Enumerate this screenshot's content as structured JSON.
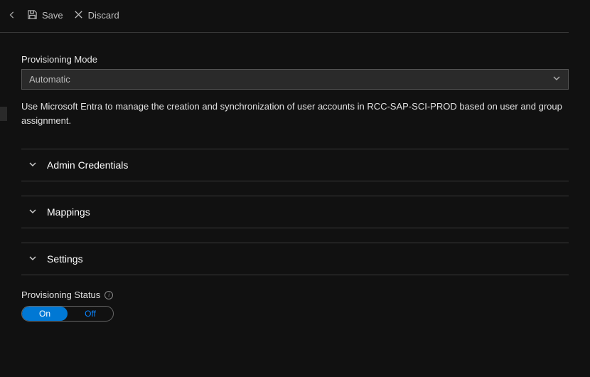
{
  "toolbar": {
    "save_label": "Save",
    "discard_label": "Discard"
  },
  "provisioning_mode": {
    "label": "Provisioning Mode",
    "value": "Automatic"
  },
  "description": "Use Microsoft Entra to manage the creation and synchronization of user accounts in RCC-SAP-SCI-PROD based on user and group assignment.",
  "sections": {
    "admin_credentials": "Admin Credentials",
    "mappings": "Mappings",
    "settings": "Settings"
  },
  "provisioning_status": {
    "label": "Provisioning Status",
    "on": "On",
    "off": "Off"
  }
}
